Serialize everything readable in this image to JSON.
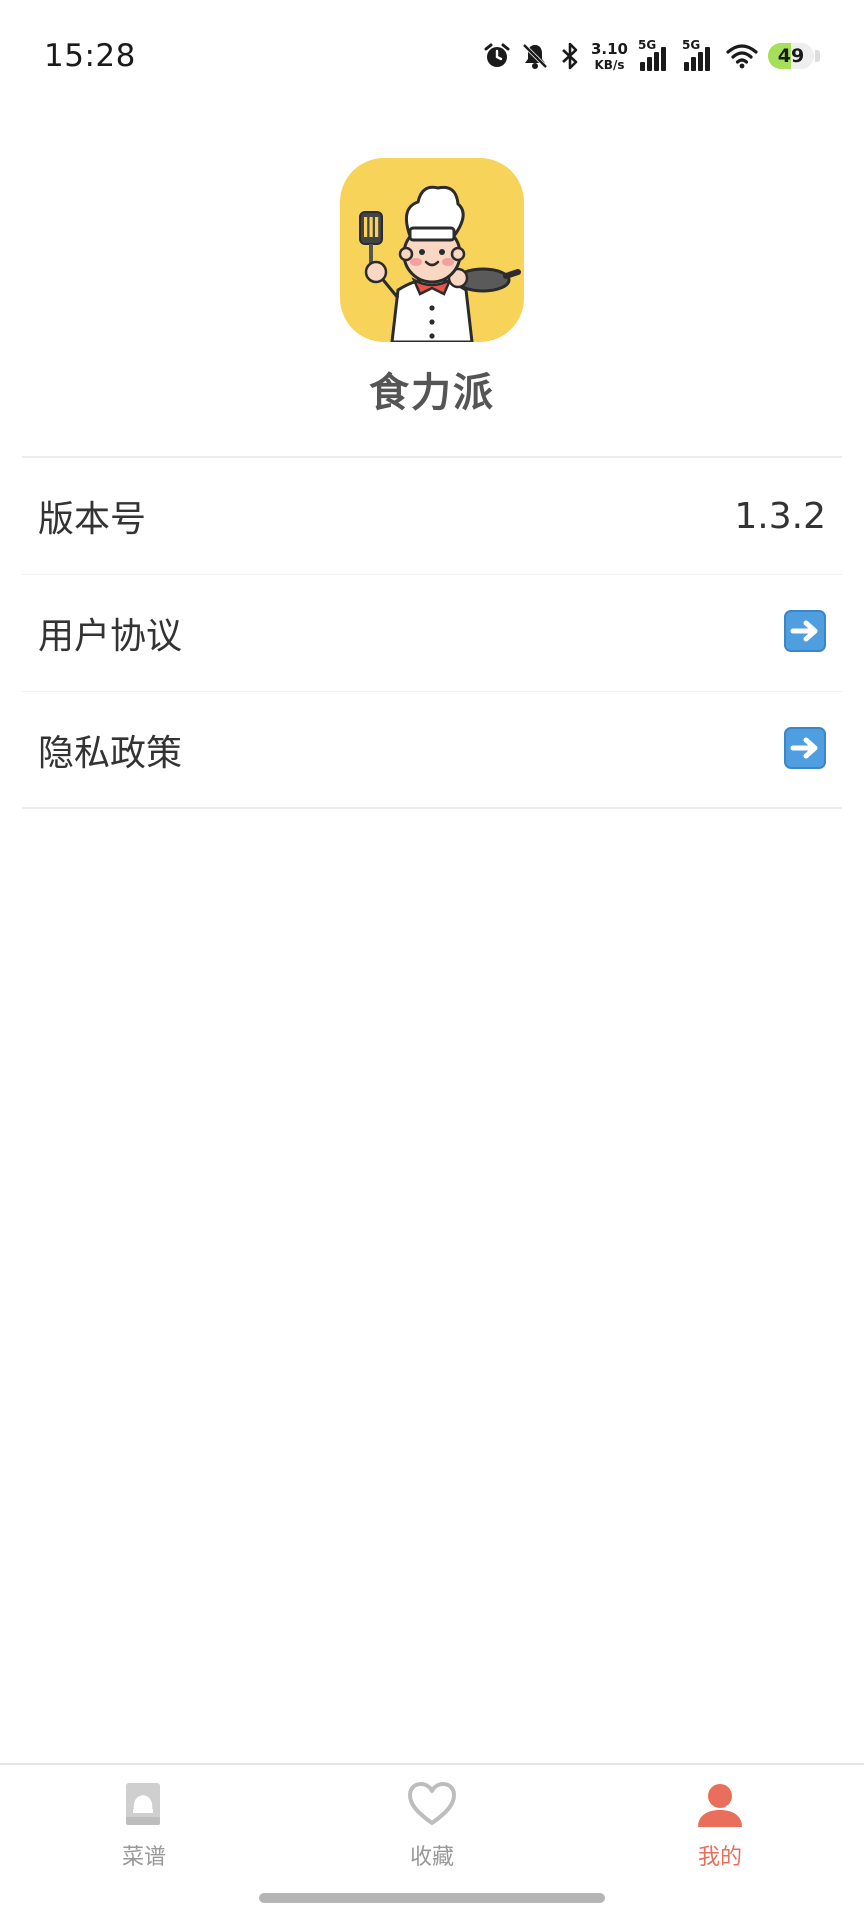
{
  "status_bar": {
    "time": "15:28",
    "net_speed_value": "3.10",
    "net_speed_unit": "KB/s",
    "sim1_label": "5G",
    "sim2_label": "5G",
    "battery_level": "49",
    "battery_fraction": 0.49,
    "icons": [
      "alarm-icon",
      "mute-icon",
      "bluetooth-icon",
      "wifi-icon",
      "battery-icon"
    ]
  },
  "app": {
    "name": "食力派",
    "logo_icon": "chef-logo",
    "logo_bg": "#f7d35a"
  },
  "settings": [
    {
      "label": "版本号",
      "value": "1.3.2"
    },
    {
      "label": "用户协议",
      "icon": "arrow-right-icon"
    },
    {
      "label": "隐私政策",
      "icon": "arrow-right-icon"
    }
  ],
  "tabs": [
    {
      "label": "菜谱",
      "icon": "recipe-book-icon",
      "active": false
    },
    {
      "label": "收藏",
      "icon": "heart-icon",
      "active": false
    },
    {
      "label": "我的",
      "icon": "user-icon",
      "active": true
    }
  ],
  "colors": {
    "accent": "#e96f5c",
    "tab_inactive": "#999999",
    "arrow_icon_bg": "#4f9ee0"
  }
}
